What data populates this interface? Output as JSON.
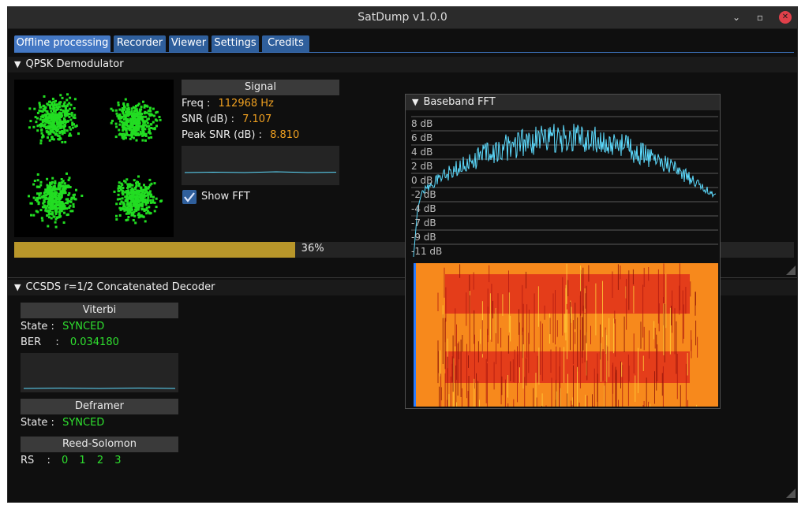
{
  "window": {
    "title": "SatDump v1.0.0"
  },
  "tabs": [
    {
      "label": "Offline processing",
      "active": true
    },
    {
      "label": "Recorder",
      "active": false
    },
    {
      "label": "Viewer",
      "active": false
    },
    {
      "label": "Settings",
      "active": false
    },
    {
      "label": "Credits",
      "active": false
    }
  ],
  "demod": {
    "title": "QPSK Demodulator",
    "signal_label": "Signal",
    "freq_label": "Freq :",
    "freq_value": "112968 Hz",
    "snr_label": "SNR (dB) :",
    "snr_value": "7.107",
    "peak_label": "Peak SNR (dB) :",
    "peak_value": "8.810",
    "show_fft_label": "Show FFT",
    "show_fft_checked": true,
    "progress_text": "36%",
    "progress_fraction": 0.36
  },
  "decoder": {
    "title": "CCSDS r=1/2 Concatenated Decoder",
    "viterbi_label": "Viterbi",
    "viterbi_state_label": "State :",
    "viterbi_state_value": "SYNCED",
    "ber_label": "BER",
    "ber_sep": ":",
    "ber_value": "0.034180",
    "deframer_label": "Deframer",
    "deframer_state_label": "State :",
    "deframer_state_value": "SYNCED",
    "rs_label": "Reed-Solomon",
    "rs_name": "RS",
    "rs_sep": ":",
    "rs_values": [
      "0",
      "1",
      "2",
      "3"
    ]
  },
  "fft": {
    "title": "Baseband FFT",
    "db_labels": [
      "8 dB",
      "6 dB",
      "4 dB",
      "2 dB",
      "0 dB",
      "-2 dB",
      "-4 dB",
      "-7 dB",
      "-9 dB",
      "-11 dB"
    ]
  },
  "colors": {
    "constellation": "#22dd22",
    "fft_line": "#5ddcff",
    "accent": "#4478c4",
    "progress": "#b8962a"
  },
  "icons": {
    "collapse": "triangle-down-icon",
    "check": "checkmark-icon"
  }
}
